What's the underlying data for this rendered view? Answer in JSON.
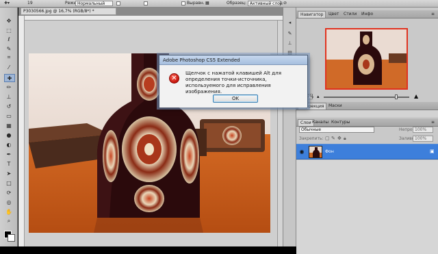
{
  "options_bar": {
    "brush_size": "19",
    "mode_label": "Режим:",
    "mode_value": "Нормальный",
    "aligned_label": "Выравн.",
    "sample_label": "Образец:",
    "sample_value": "Активный слой"
  },
  "document": {
    "tab_title": "P3030566.jpg @ 16,7% (RGB/8*) *"
  },
  "dialog": {
    "title": "Adobe Photoshop CS5 Extended",
    "message": "Щелчок с нажатой клавишей Alt для определения точки-источника, используемого для исправления изображения.",
    "ok_label": "OK",
    "icon": "error-icon"
  },
  "navigator_panel": {
    "tabs": [
      "Навигатор",
      "Цвет",
      "Стили",
      "Инфо"
    ],
    "zoom_value": "16,7%"
  },
  "adjustments_panel": {
    "tabs": [
      "Коррекция",
      "Маски"
    ]
  },
  "layers_panel": {
    "tabs": [
      "Слои",
      "Каналы",
      "Контуры"
    ],
    "blend_mode": "Обычные",
    "opacity_label": "Непрозр.:",
    "opacity_value": "100%",
    "lock_label": "Закрепить:",
    "fill_label": "Заливка:",
    "fill_value": "100%",
    "layers": [
      {
        "name": "Фон",
        "visible": true,
        "locked": true
      }
    ]
  },
  "toolbar": {
    "tools": [
      "move-tool",
      "marquee-tool",
      "lasso-tool",
      "quick-select-tool",
      "crop-tool",
      "eyedropper-tool",
      "healing-brush-tool",
      "brush-tool",
      "clone-stamp-tool",
      "history-brush-tool",
      "eraser-tool",
      "gradient-tool",
      "blur-tool",
      "dodge-tool",
      "pen-tool",
      "type-tool",
      "path-select-tool",
      "shape-tool",
      "3d-rotate-tool",
      "3d-orbit-tool",
      "hand-tool",
      "zoom-tool"
    ],
    "active_tool": "healing-brush-tool",
    "foreground_color": "#000000",
    "background_color": "#ffffff"
  },
  "colors": {
    "layer_selected": "#3d7fdb",
    "navigator_frame": "#e0321f",
    "dialog_error": "#c4120a"
  }
}
